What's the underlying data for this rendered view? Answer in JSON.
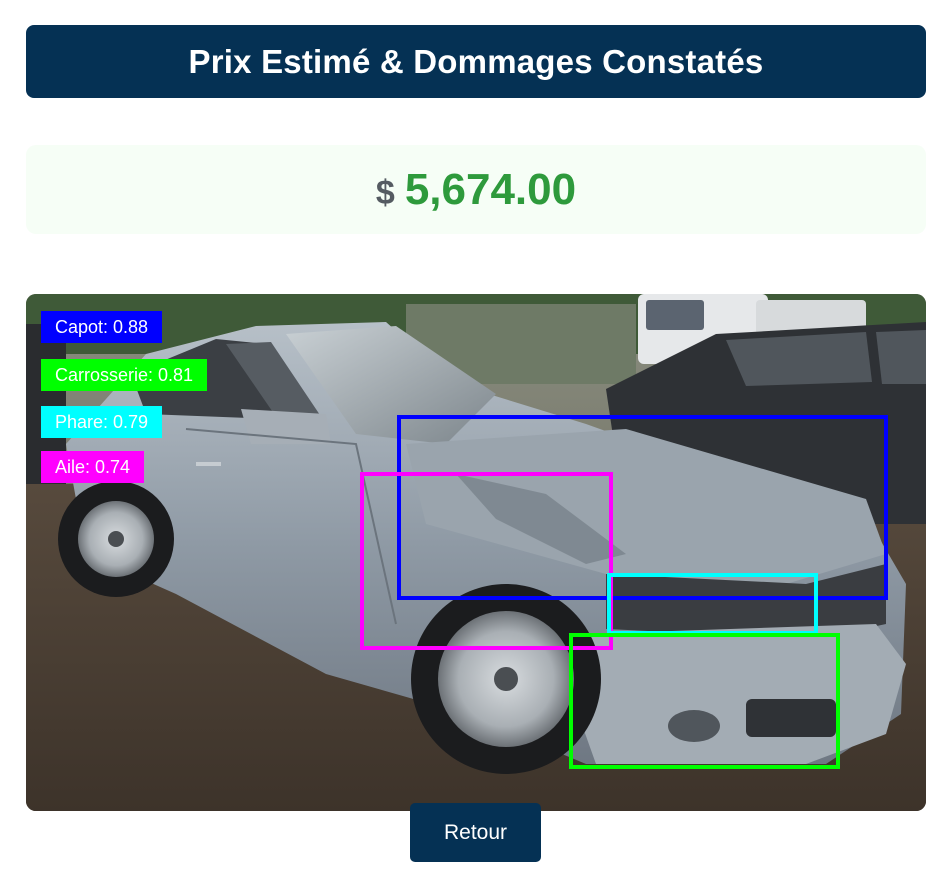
{
  "header": {
    "title": "Prix Estimé & Dommages Constatés"
  },
  "price": {
    "currency": "$",
    "value": "5,674.00",
    "value_color": "#2e9a3c"
  },
  "detections": [
    {
      "label": "Capot: 0.88",
      "part": "Capot",
      "score": 0.88,
      "color": "#0000ff"
    },
    {
      "label": "Carrosserie: 0.81",
      "part": "Carrosserie",
      "score": 0.81,
      "color": "#00ff00"
    },
    {
      "label": "Phare: 0.79",
      "part": "Phare",
      "score": 0.79,
      "color": "#00ffff"
    },
    {
      "label": "Aile: 0.74",
      "part": "Aile",
      "score": 0.74,
      "color": "#ff00ff"
    }
  ],
  "actions": {
    "back_label": "Retour"
  },
  "theme": {
    "primary": "#053154",
    "price_card_bg": "#f6fef6"
  }
}
